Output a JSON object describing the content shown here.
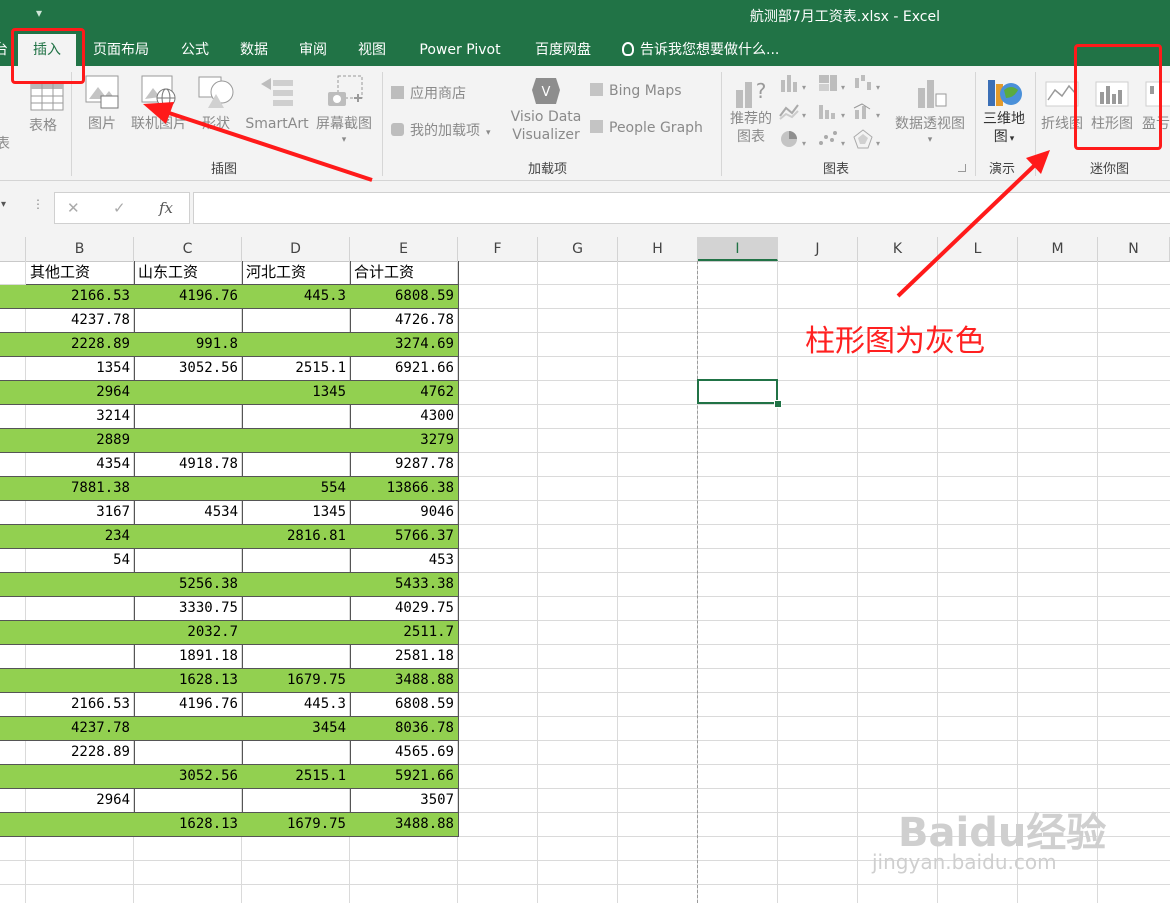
{
  "window": {
    "title": "航测部7月工资表.xlsx - Excel",
    "qat": "▾"
  },
  "tabs": [
    {
      "label": "插入",
      "active": true
    },
    {
      "label": "页面布局"
    },
    {
      "label": "公式"
    },
    {
      "label": "数据"
    },
    {
      "label": "审阅"
    },
    {
      "label": "视图"
    },
    {
      "label": "Power Pivot"
    },
    {
      "label": "百度网盘"
    }
  ],
  "tab_partial_left": "台",
  "tell_me": "告诉我您想要做什么...",
  "ribbon": {
    "table_partial": "表",
    "tables": {
      "table": "表格"
    },
    "illustrations": {
      "label": "插图",
      "picture": "图片",
      "online_picture": "联机图片",
      "shapes": "形状",
      "smartart": "SmartArt",
      "screenshot": "屏幕截图"
    },
    "addins": {
      "label": "加载项",
      "store": "应用商店",
      "my_addins": "我的加载项",
      "visio_line1": "Visio Data",
      "visio_line2": "Visualizer",
      "bing_maps": "Bing Maps",
      "people_graph": "People Graph"
    },
    "charts": {
      "label": "图表",
      "recommended_line1": "推荐的",
      "recommended_line2": "图表",
      "pivot_chart": "数据透视图"
    },
    "tours": {
      "label": "演示",
      "map3d_line1": "三维地",
      "map3d_line2": "图"
    },
    "sparklines": {
      "label": "迷你图",
      "line": "折线图",
      "column": "柱形图",
      "winloss_partial": "盈亏"
    }
  },
  "formula_bar": {
    "fx": "fx",
    "cancel": "✕",
    "enter": "✓",
    "value": ""
  },
  "columns": [
    "B",
    "C",
    "D",
    "E",
    "F",
    "G",
    "H",
    "I",
    "J",
    "K",
    "L",
    "M",
    "N"
  ],
  "selected_column": "I",
  "headers": [
    "其他工资",
    "山东工资",
    "河北工资",
    "合计工资"
  ],
  "rows": [
    {
      "b": "2166.53",
      "c": "4196.76",
      "d": "445.3",
      "e": "6808.59",
      "green": true
    },
    {
      "b": "4237.78",
      "c": "",
      "d": "",
      "e": "4726.78",
      "green": false
    },
    {
      "b": "2228.89",
      "c": "991.8",
      "d": "",
      "e": "3274.69",
      "green": true
    },
    {
      "b": "1354",
      "c": "3052.56",
      "d": "2515.1",
      "e": "6921.66",
      "green": false
    },
    {
      "b": "2964",
      "c": "",
      "d": "1345",
      "e": "4762",
      "green": true
    },
    {
      "b": "3214",
      "c": "",
      "d": "",
      "e": "4300",
      "green": false
    },
    {
      "b": "2889",
      "c": "",
      "d": "",
      "e": "3279",
      "green": true
    },
    {
      "b": "4354",
      "c": "4918.78",
      "d": "",
      "e": "9287.78",
      "green": false
    },
    {
      "b": "7881.38",
      "c": "",
      "d": "554",
      "e": "13866.38",
      "green": true
    },
    {
      "b": "3167",
      "c": "4534",
      "d": "1345",
      "e": "9046",
      "green": false
    },
    {
      "b": "234",
      "c": "",
      "d": "2816.81",
      "e": "5766.37",
      "green": true
    },
    {
      "b": "54",
      "c": "",
      "d": "",
      "e": "453",
      "green": false
    },
    {
      "b": "",
      "c": "5256.38",
      "d": "",
      "e": "5433.38",
      "green": true
    },
    {
      "b": "",
      "c": "3330.75",
      "d": "",
      "e": "4029.75",
      "green": false
    },
    {
      "b": "",
      "c": "2032.7",
      "d": "",
      "e": "2511.7",
      "green": true
    },
    {
      "b": "",
      "c": "1891.18",
      "d": "",
      "e": "2581.18",
      "green": false
    },
    {
      "b": "",
      "c": "1628.13",
      "d": "1679.75",
      "e": "3488.88",
      "green": true
    },
    {
      "b": "2166.53",
      "c": "4196.76",
      "d": "445.3",
      "e": "6808.59",
      "green": false
    },
    {
      "b": "4237.78",
      "c": "",
      "d": "3454",
      "e": "8036.78",
      "green": true
    },
    {
      "b": "2228.89",
      "c": "",
      "d": "",
      "e": "4565.69",
      "green": false
    },
    {
      "b": "",
      "c": "3052.56",
      "d": "2515.1",
      "e": "5921.66",
      "green": true
    },
    {
      "b": "2964",
      "c": "",
      "d": "",
      "e": "3507",
      "green": false
    },
    {
      "b": "",
      "c": "1628.13",
      "d": "1679.75",
      "e": "3488.88",
      "green": true
    }
  ],
  "annotation": {
    "text": "柱形图为灰色",
    "color": "#ff2020"
  },
  "watermark": {
    "brand": "Baidu经验",
    "url": "jingyan.baidu.com"
  },
  "colors": {
    "excel_green": "#217346",
    "row_fill": "#92d050",
    "annotation_red": "#ff1a1a"
  }
}
